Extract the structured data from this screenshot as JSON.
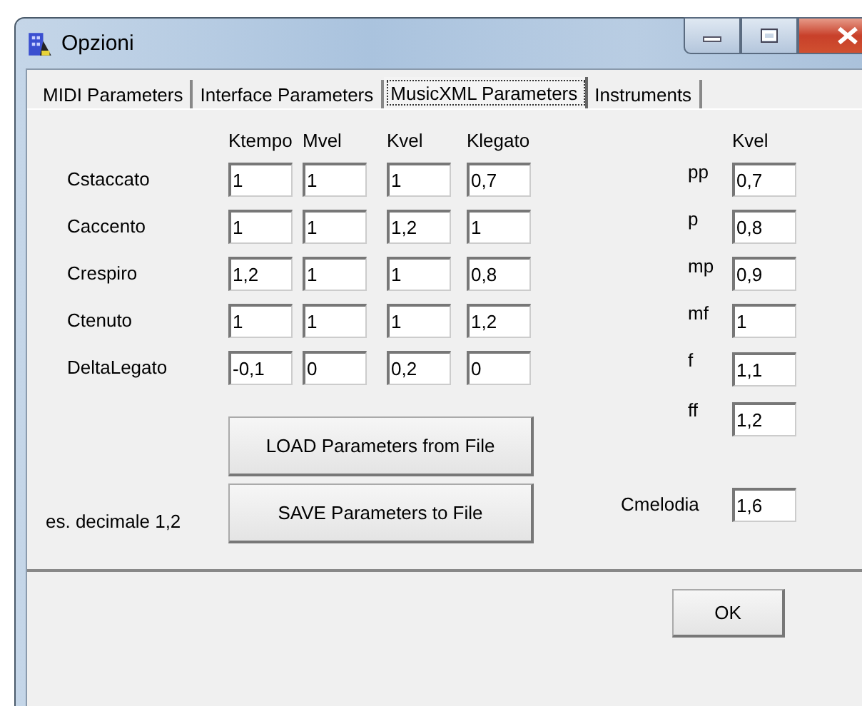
{
  "window": {
    "title": "Opzioni"
  },
  "tabs": [
    {
      "label": "MIDI Parameters",
      "selected": false
    },
    {
      "label": "Interface Parameters",
      "selected": false
    },
    {
      "label": "MusicXML Parameters",
      "selected": true
    },
    {
      "label": "Instruments",
      "selected": false
    }
  ],
  "articulation": {
    "columns": [
      "Ktempo",
      "Mvel",
      "Kvel",
      "Klegato"
    ],
    "rows": [
      {
        "label": "Cstaccato",
        "values": [
          "1",
          "1",
          "1",
          "0,7"
        ]
      },
      {
        "label": "Caccento",
        "values": [
          "1",
          "1",
          "1,2",
          "1"
        ]
      },
      {
        "label": "Crespiro",
        "values": [
          "1,2",
          "1",
          "1",
          "0,8"
        ]
      },
      {
        "label": "Ctenuto",
        "values": [
          "1",
          "1",
          "1",
          "1,2"
        ]
      },
      {
        "label": "DeltaLegato",
        "values": [
          "-0,1",
          "0",
          "0,2",
          "0"
        ]
      }
    ]
  },
  "dynamics": {
    "column": "Kvel",
    "rows": [
      {
        "label": "pp",
        "value": "0,7"
      },
      {
        "label": "p",
        "value": "0,8"
      },
      {
        "label": "mp",
        "value": "0,9"
      },
      {
        "label": "mf",
        "value": "1"
      },
      {
        "label": "f",
        "value": "1,1"
      },
      {
        "label": "ff",
        "value": "1,2"
      }
    ]
  },
  "cmelodia": {
    "label": "Cmelodia",
    "value": "1,6"
  },
  "note": "es. decimale 1,2",
  "buttons": [
    "LOAD Parameters from File",
    "SAVE Parameters to File"
  ],
  "ok_button": "OK"
}
